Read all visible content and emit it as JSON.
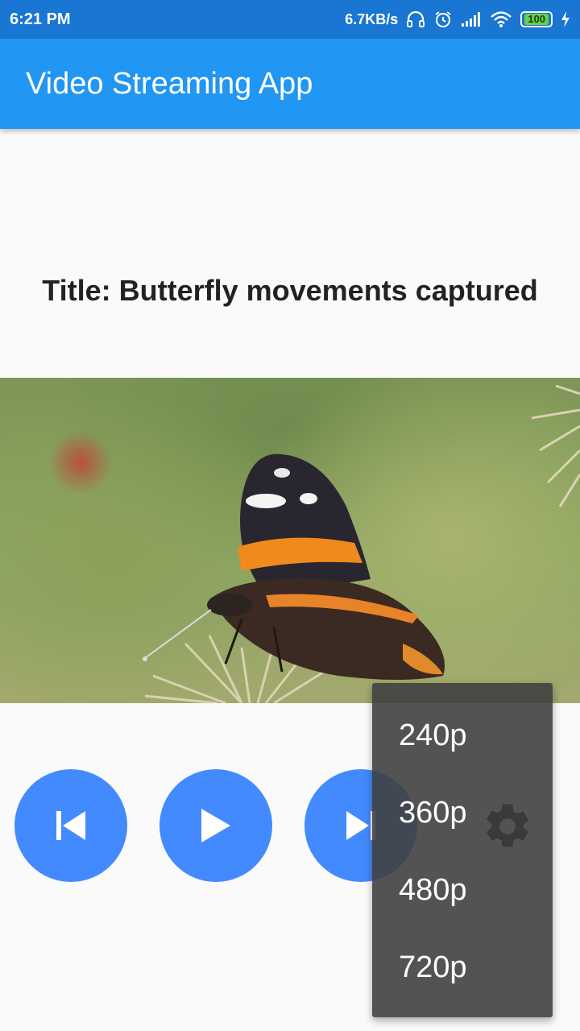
{
  "status_bar": {
    "time": "6:21 PM",
    "network_speed": "6.7KB/s",
    "battery_level": "100",
    "icons": [
      "headphones-icon",
      "alarm-icon",
      "signal-icon",
      "wifi-icon",
      "battery-icon",
      "charging-icon"
    ]
  },
  "app_bar": {
    "title": "Video Streaming App",
    "color": "#2196f3"
  },
  "video": {
    "title": "Title: Butterfly movements captured"
  },
  "controls": {
    "buttons": [
      "skip-previous-icon",
      "play-icon",
      "skip-next-icon"
    ],
    "button_color": "#448aff",
    "settings_icon": "gear-icon"
  },
  "quality_menu": {
    "options": [
      "240p",
      "360p",
      "480p",
      "720p"
    ]
  }
}
